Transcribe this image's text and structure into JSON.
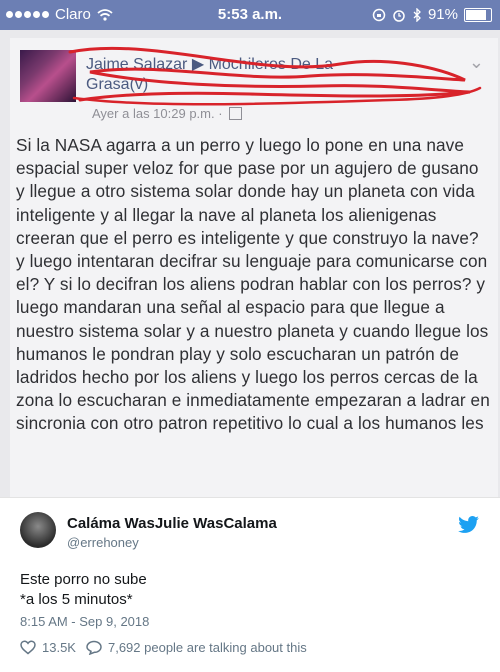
{
  "status_bar": {
    "carrier": "Claro",
    "time": "5:53 a.m.",
    "battery": "91%",
    "battery_level": 0.91
  },
  "post": {
    "author_names": "Jaime Salazar ▶ Mochileros De La",
    "group_line2": "Grasa(v)",
    "timestamp": "Ayer a las 10:29 p.m. ·",
    "body": "Si la NASA agarra a un perro y luego lo pone en una nave espacial super veloz for que pase por un agujero de gusano y llegue a otro sistema solar donde hay un planeta con vida inteligente y al llegar la nave al planeta los alienigenas creeran que el perro es inteligente y que construyo la nave? y luego intentaran decifrar su lenguaje para comunicarse con el? Y si lo decifran los aliens podran hablar con los perros? y luego mandaran una señal al espacio para que llegue a nuestro sistema solar y a nuestro planeta y cuando llegue los humanos le pondran play y solo escucharan un patrón de ladridos hecho por los aliens y luego los perros cercas de la zona lo escucharan e inmediatamente empezaran a ladrar en sincronia con otro patron repetitivo lo cual a los humanos les"
  },
  "tweet": {
    "display_name": "Caláma WasJulie WasCalama",
    "handle": "@errehoney",
    "text_line1": "Este porro no sube",
    "text_line2": "*a los 5 minutos*",
    "timestamp": "8:15 AM - Sep 9, 2018",
    "likes": "13.5K",
    "talking": "7,692 people are talking about this"
  },
  "icons": [
    "signal-dots-icon",
    "wifi-icon",
    "lock-rotation-icon",
    "alarm-icon",
    "bluetooth-icon",
    "battery-icon",
    "chevron-down-icon",
    "globe-icon",
    "twitter-bird-icon",
    "heart-icon",
    "comment-icon"
  ],
  "colors": {
    "statusbar": "#6c7fb4",
    "scribble": "#d8232a",
    "link": "#4b5a80",
    "twitter": "#1da1f2"
  }
}
